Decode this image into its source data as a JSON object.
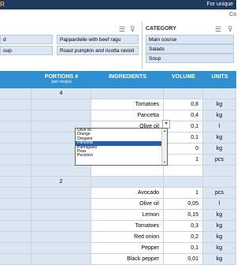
{
  "topbar": {
    "brand": "R",
    "message": "For unique"
  },
  "subbar": {
    "text": "Co"
  },
  "slicers": {
    "left_col": [
      "d",
      "oup"
    ],
    "mid_col": [
      "Pappardelle with beef ragu",
      "Roast pumpkin and ricotta ravioli"
    ]
  },
  "category": {
    "title": "CATEGORY",
    "items": [
      "Main course",
      "Salads",
      "Soup"
    ]
  },
  "icons": {
    "multiselect": "multi-select-icon",
    "clear_filter": "clear-filter-icon"
  },
  "table": {
    "headers": {
      "first": "",
      "portions": "PORTIONS #",
      "portions_sub": "(per recipe)",
      "ingredients": "INGREDIENTS",
      "volume": "VOLUME",
      "units": "UNITS"
    },
    "rows": [
      {
        "portions": "4",
        "ingredient": "",
        "volume": "",
        "units": "",
        "band": true
      },
      {
        "portions": "",
        "ingredient": "Tomatoes",
        "volume": "0,8",
        "units": "kg"
      },
      {
        "portions": "",
        "ingredient": "Pancetta",
        "volume": "0,4",
        "units": "kg"
      },
      {
        "portions": "",
        "ingredient": "Olive oil",
        "volume": "0,1",
        "units": "l"
      },
      {
        "portions": "",
        "ingredient": "",
        "volume": "0,1",
        "units": "kg"
      },
      {
        "portions": "",
        "ingredient": "",
        "volume": "0",
        "units": "kg"
      },
      {
        "portions": "",
        "ingredient": "",
        "volume": "1",
        "units": "pcs"
      },
      {
        "portions": "",
        "ingredient": "",
        "volume": "",
        "units": ""
      },
      {
        "portions": "2",
        "ingredient": "",
        "volume": "",
        "units": "",
        "band": true
      },
      {
        "portions": "",
        "ingredient": "Avocado",
        "volume": "1",
        "units": "pcs"
      },
      {
        "portions": "",
        "ingredient": "Olive oil",
        "volume": "0,05",
        "units": "l"
      },
      {
        "portions": "",
        "ingredient": "Lemon",
        "volume": "0,15",
        "units": "kg"
      },
      {
        "portions": "",
        "ingredient": "Tomatoes",
        "volume": "0,3",
        "units": "kg"
      },
      {
        "portions": "",
        "ingredient": "Red onion",
        "volume": "0,2",
        "units": "kg"
      },
      {
        "portions": "",
        "ingredient": "Pepper",
        "volume": "0,1",
        "units": "kg"
      },
      {
        "portions": "",
        "ingredient": "Black pepper",
        "volume": "0,01",
        "units": "kg"
      }
    ]
  },
  "dropdown": {
    "options": [
      "Olive oil",
      "Orange",
      "Oregano",
      "Pancetta",
      "Parmigiano",
      "Peas",
      "Pecorino"
    ],
    "selected_index": 3
  }
}
